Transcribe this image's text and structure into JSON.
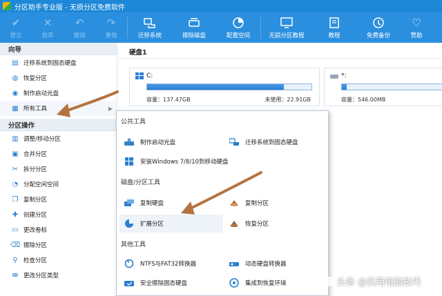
{
  "window": {
    "title": "分区助手专业版 - 无损分区免费软件"
  },
  "toolbar": {
    "buttons": [
      {
        "label": "提交",
        "icon": "check-icon"
      },
      {
        "label": "放弃",
        "icon": "x-icon"
      },
      {
        "label": "撤销",
        "icon": "undo-icon"
      },
      {
        "label": "重做",
        "icon": "redo-icon"
      },
      {
        "label": "迁移系统",
        "icon": "migrate-os-icon"
      },
      {
        "label": "擦除磁盘",
        "icon": "wipe-disk-icon"
      },
      {
        "label": "配置空间",
        "icon": "allocate-space-icon"
      },
      {
        "label": "无损分区教程",
        "icon": "tutorial-icon"
      },
      {
        "label": "教程",
        "icon": "book-icon"
      },
      {
        "label": "免费备份",
        "icon": "backup-icon"
      },
      {
        "label": "赞助",
        "icon": "heart-icon"
      }
    ]
  },
  "sidebar": {
    "wizard_title": "向导",
    "wizard_items": [
      {
        "label": "迁移系统到固态硬盘",
        "icon": "migrate-ssd-icon"
      },
      {
        "label": "恢复分区",
        "icon": "recover-partition-icon"
      },
      {
        "label": "制作启动光盘",
        "icon": "boot-disc-icon"
      },
      {
        "label": "所有工具",
        "icon": "grid-icon",
        "arrow": "▶"
      }
    ],
    "ops_title": "分区操作",
    "ops_items": [
      {
        "label": "调整/移动分区",
        "icon": "resize-icon"
      },
      {
        "label": "合并分区",
        "icon": "merge-icon"
      },
      {
        "label": "拆分分区",
        "icon": "split-icon"
      },
      {
        "label": "分配空闲空间",
        "icon": "allocate-icon"
      },
      {
        "label": "复制分区",
        "icon": "copy-icon"
      },
      {
        "label": "创建分区",
        "icon": "create-icon"
      },
      {
        "label": "更改卷标",
        "icon": "label-icon"
      },
      {
        "label": "擦除分区",
        "icon": "erase-icon"
      },
      {
        "label": "检查分区",
        "icon": "check-partition-icon"
      },
      {
        "label": "更改分区类型",
        "icon": "id-icon"
      }
    ]
  },
  "main": {
    "disk_title": "硬盘1",
    "partitions": [
      {
        "name": "C:",
        "capacity": "容量：137.47GB",
        "unused": "未使用：22.91GB",
        "used_fraction": 0.83
      },
      {
        "name": "*:",
        "capacity": "容量：546.00MB",
        "used_fraction": 0.05
      }
    ]
  },
  "popup": {
    "group_common": "公共工具",
    "group_disk": "磁盘/分区工具",
    "group_other": "其他工具",
    "common_items": [
      {
        "label": "制作启动光盘",
        "icon": "boot-disc-icon"
      },
      {
        "label": "迁移系统到固态硬盘",
        "icon": "migrate-ssd-icon"
      },
      {
        "label": "安装Windows 7/8/10到移动硬盘",
        "icon": "windows-icon"
      }
    ],
    "disk_items": [
      {
        "label": "复制硬盘",
        "icon": "copy-disk-icon"
      },
      {
        "label": "复制分区",
        "icon": "copy-partition-icon"
      },
      {
        "label": "扩展分区",
        "icon": "extend-partition-icon"
      },
      {
        "label": "恢复分区",
        "icon": "recover-partition-icon"
      }
    ],
    "other_items": [
      {
        "label": "NTFS与FAT32转换器",
        "icon": "convert-icon"
      },
      {
        "label": "动态硬盘转换器",
        "icon": "dynamic-disk-icon"
      },
      {
        "label": "安全擦除固态硬盘",
        "icon": "secure-erase-icon"
      },
      {
        "label": "集成到恢复环境",
        "icon": "recovery-env-icon"
      }
    ]
  },
  "watermark": {
    "text": "头条 @实用电脑技巧"
  },
  "colors": {
    "titlebar": "#1e88d8",
    "toolbar": "#2b8fdf",
    "arrow": "#b5733f",
    "accent": "#2b7fd0"
  }
}
